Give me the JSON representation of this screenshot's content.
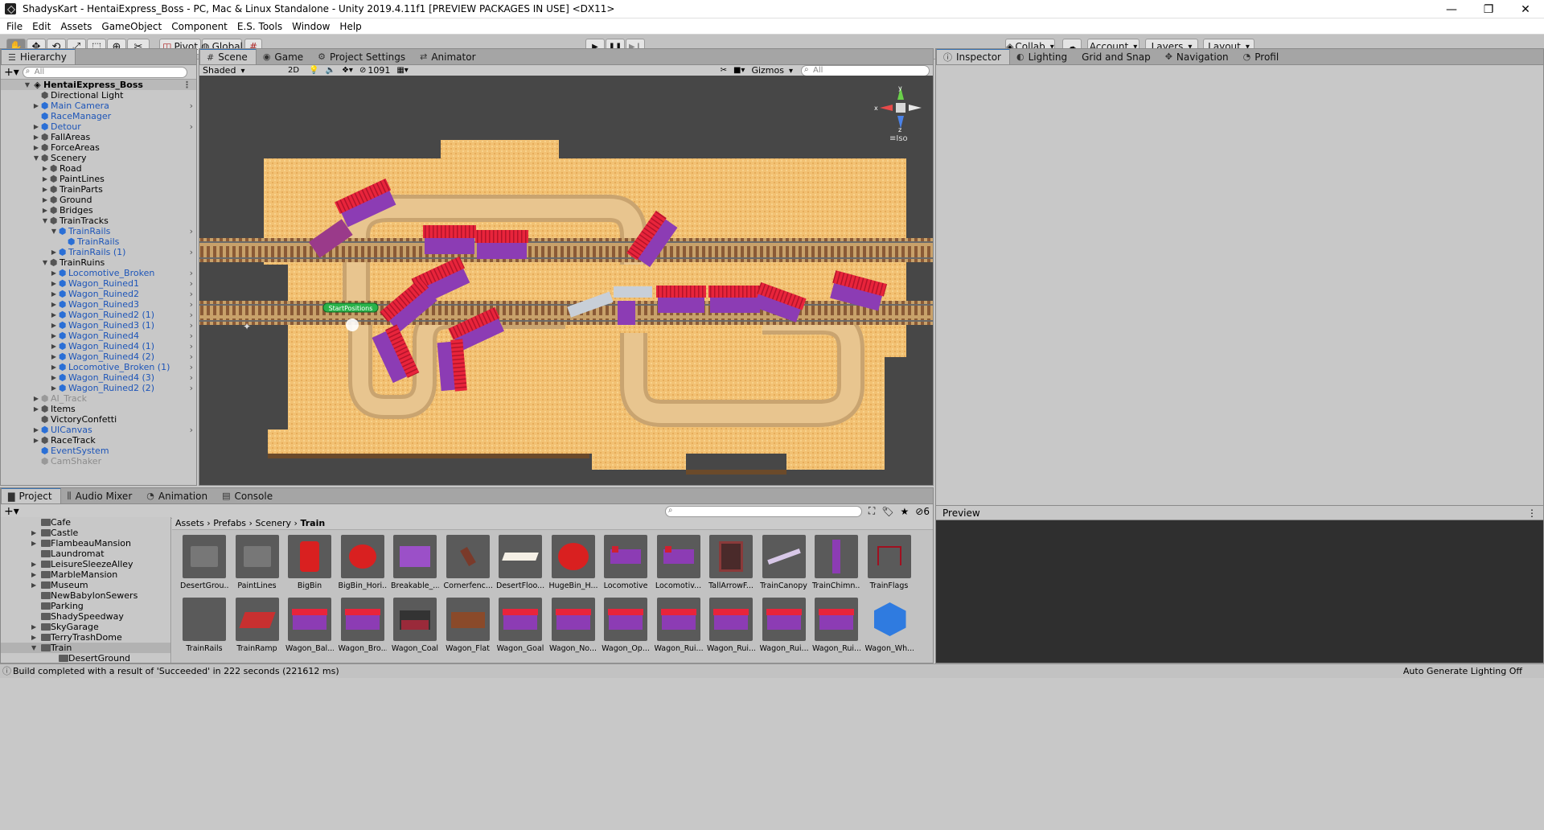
{
  "window": {
    "title": "ShadysKart - HentaiExpress_Boss - PC, Mac & Linux Standalone - Unity 2019.4.11f1 [PREVIEW PACKAGES IN USE] <DX11>",
    "minimize": "—",
    "maximize": "❐",
    "close": "✕"
  },
  "menu": [
    "File",
    "Edit",
    "Assets",
    "GameObject",
    "Component",
    "E.S. Tools",
    "Window",
    "Help"
  ],
  "toolbar": {
    "pivot": "Pivot",
    "global": "Global",
    "collab": "Collab",
    "account": "Account",
    "layers": "Layers",
    "layout": "Layout",
    "play_icon": "play-icon",
    "pause_icon": "pause-icon",
    "step_icon": "step-icon"
  },
  "hierarchy": {
    "tab": "Hierarchy",
    "search_placeholder": "All",
    "scene_root": "HentaiExpress_Boss",
    "items": [
      {
        "label": "Directional Light",
        "depth": 1,
        "arrow": false,
        "style": "normal"
      },
      {
        "label": "Main Camera",
        "depth": 1,
        "arrow": true,
        "style": "blue"
      },
      {
        "label": "RaceManager",
        "depth": 1,
        "arrow": false,
        "style": "blue"
      },
      {
        "label": "Detour",
        "depth": 1,
        "arrow": true,
        "style": "blue"
      },
      {
        "label": "FallAreas",
        "depth": 1,
        "arrow": true,
        "style": "normal"
      },
      {
        "label": "ForceAreas",
        "depth": 1,
        "arrow": true,
        "style": "normal"
      },
      {
        "label": "Scenery",
        "depth": 1,
        "arrow": true,
        "open": true,
        "style": "normal"
      },
      {
        "label": "Road",
        "depth": 2,
        "arrow": true,
        "style": "normal"
      },
      {
        "label": "PaintLines",
        "depth": 2,
        "arrow": true,
        "style": "normal"
      },
      {
        "label": "TrainParts",
        "depth": 2,
        "arrow": true,
        "style": "normal"
      },
      {
        "label": "Ground",
        "depth": 2,
        "arrow": true,
        "style": "normal"
      },
      {
        "label": "Bridges",
        "depth": 2,
        "arrow": true,
        "style": "normal"
      },
      {
        "label": "TrainTracks",
        "depth": 2,
        "arrow": true,
        "open": true,
        "style": "normal"
      },
      {
        "label": "TrainRails",
        "depth": 3,
        "arrow": true,
        "open": true,
        "style": "blue"
      },
      {
        "label": "TrainRails",
        "depth": 4,
        "arrow": false,
        "style": "blue"
      },
      {
        "label": "TrainRails (1)",
        "depth": 3,
        "arrow": true,
        "style": "blue"
      },
      {
        "label": "TrainRuins",
        "depth": 2,
        "arrow": true,
        "open": true,
        "style": "normal"
      },
      {
        "label": "Locomotive_Broken",
        "depth": 3,
        "arrow": true,
        "style": "blue"
      },
      {
        "label": "Wagon_Ruined1",
        "depth": 3,
        "arrow": true,
        "style": "blue"
      },
      {
        "label": "Wagon_Ruined2",
        "depth": 3,
        "arrow": true,
        "style": "blue"
      },
      {
        "label": "Wagon_Ruined3",
        "depth": 3,
        "arrow": true,
        "style": "blue"
      },
      {
        "label": "Wagon_Ruined2 (1)",
        "depth": 3,
        "arrow": true,
        "style": "blue"
      },
      {
        "label": "Wagon_Ruined3 (1)",
        "depth": 3,
        "arrow": true,
        "style": "blue"
      },
      {
        "label": "Wagon_Ruined4",
        "depth": 3,
        "arrow": true,
        "style": "blue"
      },
      {
        "label": "Wagon_Ruined4 (1)",
        "depth": 3,
        "arrow": true,
        "style": "blue"
      },
      {
        "label": "Wagon_Ruined4 (2)",
        "depth": 3,
        "arrow": true,
        "style": "blue"
      },
      {
        "label": "Locomotive_Broken (1)",
        "depth": 3,
        "arrow": true,
        "style": "blue"
      },
      {
        "label": "Wagon_Ruined4 (3)",
        "depth": 3,
        "arrow": true,
        "style": "blue"
      },
      {
        "label": "Wagon_Ruined2 (2)",
        "depth": 3,
        "arrow": true,
        "style": "blue"
      },
      {
        "label": "AI_Track",
        "depth": 1,
        "arrow": true,
        "style": "grey"
      },
      {
        "label": "Items",
        "depth": 1,
        "arrow": true,
        "style": "normal"
      },
      {
        "label": "VictoryConfetti",
        "depth": 1,
        "arrow": false,
        "style": "normal"
      },
      {
        "label": "UICanvas",
        "depth": 1,
        "arrow": true,
        "style": "blue"
      },
      {
        "label": "RaceTrack",
        "depth": 1,
        "arrow": true,
        "style": "normal"
      },
      {
        "label": "EventSystem",
        "depth": 1,
        "arrow": false,
        "style": "blue"
      },
      {
        "label": "CamShaker",
        "depth": 1,
        "arrow": false,
        "style": "grey"
      }
    ]
  },
  "scene": {
    "tabs": [
      "Scene",
      "Game",
      "Project Settings",
      "Animator"
    ],
    "shading": "Shaded",
    "mode_2d": "2D",
    "hidden_count": "1091",
    "gizmos": "Gizmos",
    "search_placeholder": "All",
    "iso_label": "Iso",
    "start_label": "StartPositions",
    "axis_x": "x",
    "axis_y": "y",
    "axis_z": "z"
  },
  "inspector": {
    "tabs": [
      "Inspector",
      "Lighting",
      "Grid and Snap",
      "Navigation",
      "Profil"
    ],
    "preview_label": "Preview"
  },
  "project": {
    "tabs": [
      "Project",
      "Audio Mixer",
      "Animation",
      "Console"
    ],
    "hidden_count": "6",
    "breadcrumb": [
      "Assets",
      "Prefabs",
      "Scenery",
      "Train"
    ],
    "folders": [
      {
        "label": "Cafe",
        "arrow": false
      },
      {
        "label": "Castle",
        "arrow": true
      },
      {
        "label": "FlambeauMansion",
        "arrow": true
      },
      {
        "label": "Laundromat",
        "arrow": false
      },
      {
        "label": "LeisureSleezeAlley",
        "arrow": true
      },
      {
        "label": "MarbleMansion",
        "arrow": true
      },
      {
        "label": "Museum",
        "arrow": true
      },
      {
        "label": "NewBabylonSewers",
        "arrow": false
      },
      {
        "label": "Parking",
        "arrow": false
      },
      {
        "label": "ShadySpeedway",
        "arrow": false
      },
      {
        "label": "SkyGarage",
        "arrow": true
      },
      {
        "label": "TerryTrashDome",
        "arrow": true
      },
      {
        "label": "Train",
        "arrow": true,
        "selected": true
      },
      {
        "label": "DesertGround",
        "arrow": false,
        "child": true
      }
    ],
    "assets_row1": [
      "DesertGrou...",
      "PaintLines",
      "BigBin",
      "BigBin_Hori...",
      "Breakable_...",
      "Cornerfenc...",
      "DesertFloo...",
      "HugeBin_H...",
      "Locomotive",
      "Locomotiv...",
      "TallArrowF...",
      "TrainCanopy",
      "TrainChimn...",
      "TrainFlags"
    ],
    "assets_row2": [
      "TrainRails",
      "TrainRamp",
      "Wagon_Bal...",
      "Wagon_Bro...",
      "Wagon_Coal",
      "Wagon_Flat",
      "Wagon_Goal",
      "Wagon_No...",
      "Wagon_Op...",
      "Wagon_Rui...",
      "Wagon_Rui...",
      "Wagon_Rui...",
      "Wagon_Rui...",
      "Wagon_Wh..."
    ]
  },
  "status": {
    "message": "Build completed with a result of 'Succeeded' in 222 seconds (221612 ms)",
    "right": "Auto Generate Lighting Off"
  },
  "colors": {
    "sand": "#f2c173",
    "wagon_red": "#e8243b",
    "wagon_purple": "#8c3cb4",
    "scene_bg": "#474747",
    "accent_blue": "#1d55b8"
  }
}
